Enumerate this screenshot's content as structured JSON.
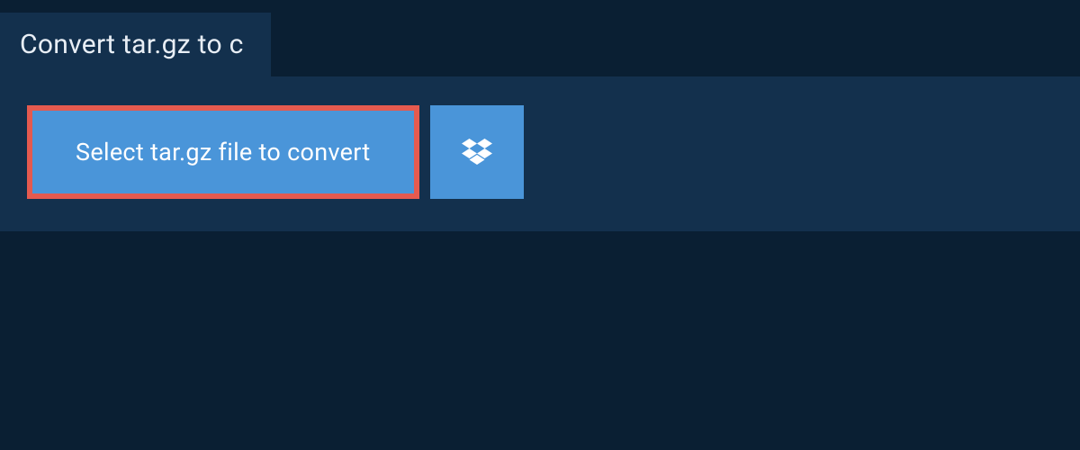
{
  "tab": {
    "title": "Convert tar.gz to c"
  },
  "panel": {
    "select_button_label": "Select tar.gz file to convert",
    "dropbox_icon_name": "dropbox-icon"
  },
  "colors": {
    "background": "#0a1f33",
    "panel": "#13304d",
    "button_bg": "#4a95d9",
    "highlight_border": "#e55a4f",
    "text_light": "#ffffff"
  }
}
